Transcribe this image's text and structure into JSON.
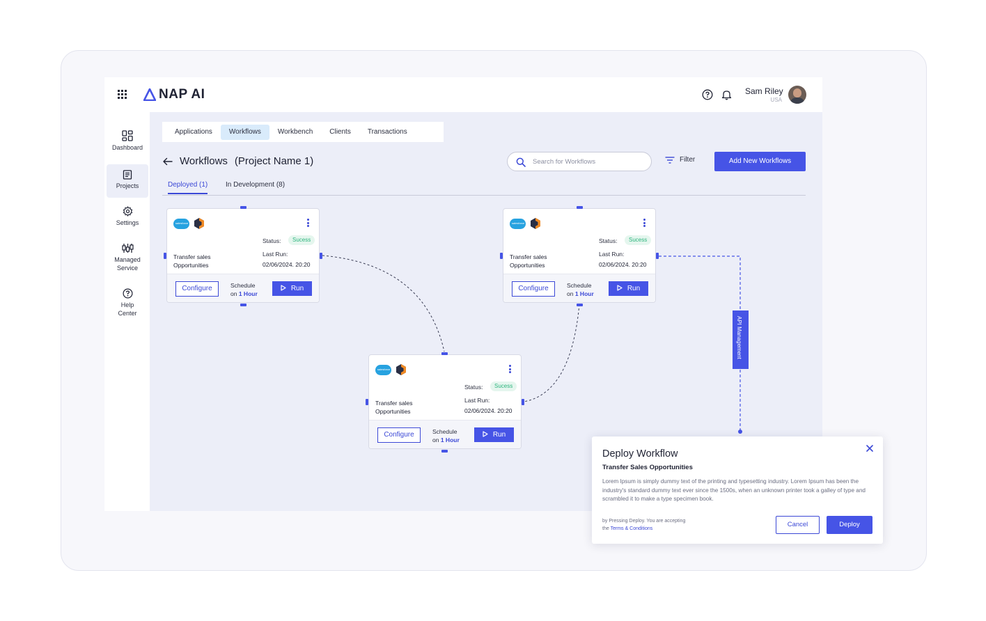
{
  "app": {
    "logo_text": "NAP AI",
    "user": {
      "name": "Sam Riley",
      "location": "USA"
    },
    "accent": "#4654e6"
  },
  "sidebar": {
    "items": [
      {
        "label": "Dashboard",
        "icon": "dashboard-icon"
      },
      {
        "label": "Projects",
        "icon": "projects-icon"
      },
      {
        "label": "Settings",
        "icon": "gear-icon"
      },
      {
        "label": "Managed Service",
        "icon": "sliders-icon"
      },
      {
        "label": "Help Center",
        "icon": "help-circle-icon"
      }
    ]
  },
  "tabs": [
    "Applications",
    "Workflows",
    "Workbench",
    "Clients",
    "Transactions"
  ],
  "page": {
    "title": "Workflows",
    "project": "(Project Name 1)",
    "search_placeholder": "Search for Workflows",
    "filter_label": "Filter",
    "add_button": "Add New Workflows",
    "subtabs": [
      "Deployed (1)",
      "In Development (8)"
    ]
  },
  "cards": [
    {
      "status_label": "Status:",
      "status": "Sucess",
      "name_line1": "Transfer sales",
      "name_line2": "Opportunities",
      "last_run_label": "Last Run:",
      "last_run": "02/06/2024. 20:20",
      "configure": "Configure",
      "schedule_line1": "Schedule",
      "schedule_on": "on",
      "schedule_value": "1 Hour",
      "run": "Run"
    },
    {
      "status_label": "Status:",
      "status": "Sucess",
      "name_line1": "Transfer sales",
      "name_line2": "Opportunities",
      "last_run_label": "Last Run:",
      "last_run": "02/06/2024. 20:20",
      "configure": "Configure",
      "schedule_line1": "Schedule",
      "schedule_on": "on",
      "schedule_value": "1 Hour",
      "run": "Run"
    },
    {
      "status_label": "Status:",
      "status": "Sucess",
      "name_line1": "Transfer sales",
      "name_line2": "Opportunities",
      "last_run_label": "Last Run:",
      "last_run": "02/06/2024. 20:20",
      "configure": "Configure",
      "schedule_line1": "Schedule",
      "schedule_on": "on",
      "schedule_value": "1 Hour",
      "run": "Run"
    }
  ],
  "api_label": "API Management",
  "modal": {
    "title": "Deploy Workflow",
    "subtitle": "Transfer Sales Opportunities",
    "body": "Lorem Ipsum is simply dummy text of the printing and typesetting industry. Lorem Ipsum has been the industry's standard dummy text ever since the 1500s, when an unknown printer took a galley of type and scrambled it to make a type specimen book.",
    "terms_prefix": "by Pressing Deploy. You are accepting",
    "terms_the": "the",
    "terms_link": "Terms & Conditions",
    "cancel": "Cancel",
    "deploy": "Deploy"
  }
}
